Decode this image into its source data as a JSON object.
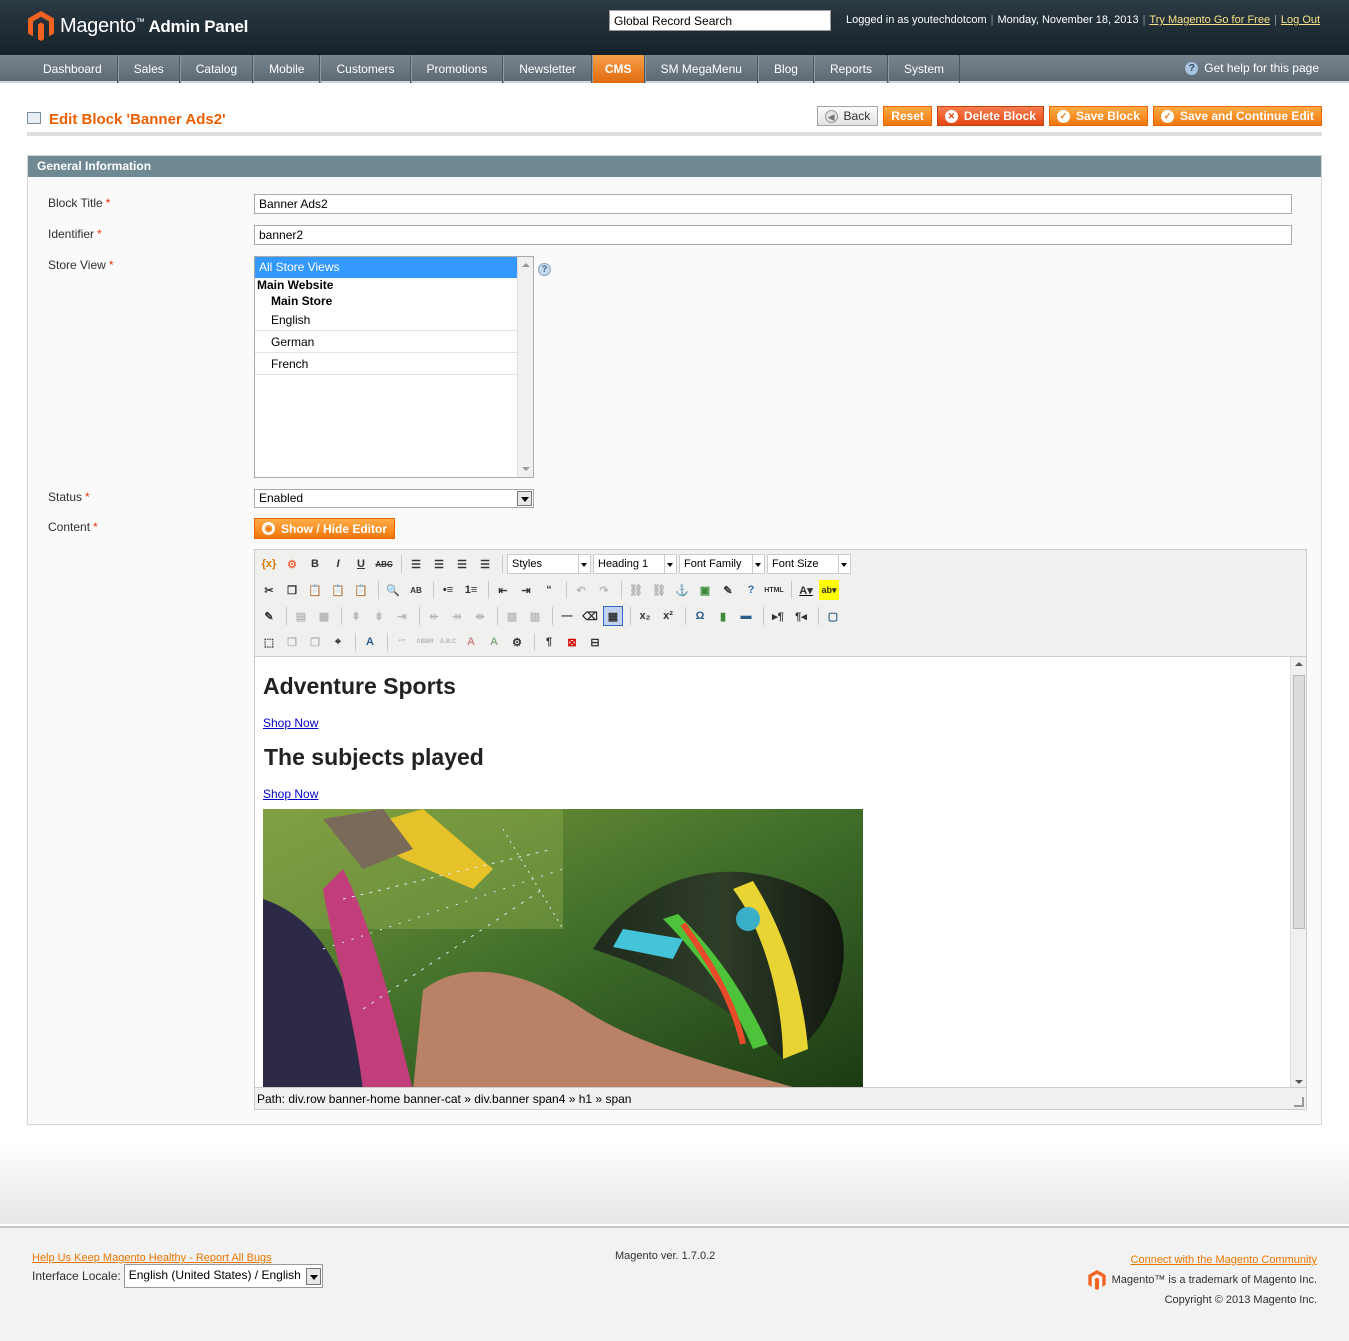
{
  "header": {
    "logo_main": "Magento",
    "logo_tm": "™",
    "logo_sub": "Admin Panel",
    "global_search_value": "Global Record Search",
    "logged_in": "Logged in as youtechdotcom",
    "date": "Monday, November 18, 2013",
    "try_link": "Try Magento Go for Free",
    "logout": "Log Out"
  },
  "nav": {
    "items": [
      "Dashboard",
      "Sales",
      "Catalog",
      "Mobile",
      "Customers",
      "Promotions",
      "Newsletter",
      "CMS",
      "SM MegaMenu",
      "Blog",
      "Reports",
      "System"
    ],
    "active": "CMS",
    "help": "Get help for this page"
  },
  "page": {
    "title": "Edit Block 'Banner Ads2'",
    "buttons": {
      "back": "Back",
      "reset": "Reset",
      "delete": "Delete Block",
      "save": "Save Block",
      "save_continue": "Save and Continue Edit"
    }
  },
  "form": {
    "legend": "General Information",
    "block_title_label": "Block Title",
    "block_title_value": "Banner Ads2",
    "identifier_label": "Identifier",
    "identifier_value": "banner2",
    "store_view_label": "Store View",
    "store_view": {
      "selected": "All Store Views",
      "website": "Main Website",
      "store": "Main Store",
      "views": [
        "English",
        "German",
        "French"
      ]
    },
    "status_label": "Status",
    "status_value": "Enabled",
    "content_label": "Content",
    "show_hide": "Show / Hide Editor",
    "required_mark": "*"
  },
  "editor": {
    "selects": [
      "Styles",
      "Heading 1",
      "Font Family",
      "Font Size"
    ],
    "content": {
      "heading1": "Adventure Sports",
      "link1": "Shop Now",
      "heading2": "The subjects played",
      "link2": "Shop Now"
    },
    "path": "Path: div.row banner-home banner-cat » div.banner span4 » h1 » span"
  },
  "footer": {
    "bugs_link": "Help Us Keep Magento Healthy - Report All Bugs",
    "locale_label": "Interface Locale:",
    "locale_value": "English (United States) / English",
    "version": "Magento ver. 1.7.0.2",
    "community_link": "Connect with the Magento Community",
    "trademark": "Magento™ is a trademark of Magento Inc.",
    "copyright": "Copyright © 2013 Magento Inc."
  },
  "colors": {
    "accent_orange": "#eb5e00",
    "header_bg": "#1f2d35",
    "legend_bg": "#6f8992"
  }
}
